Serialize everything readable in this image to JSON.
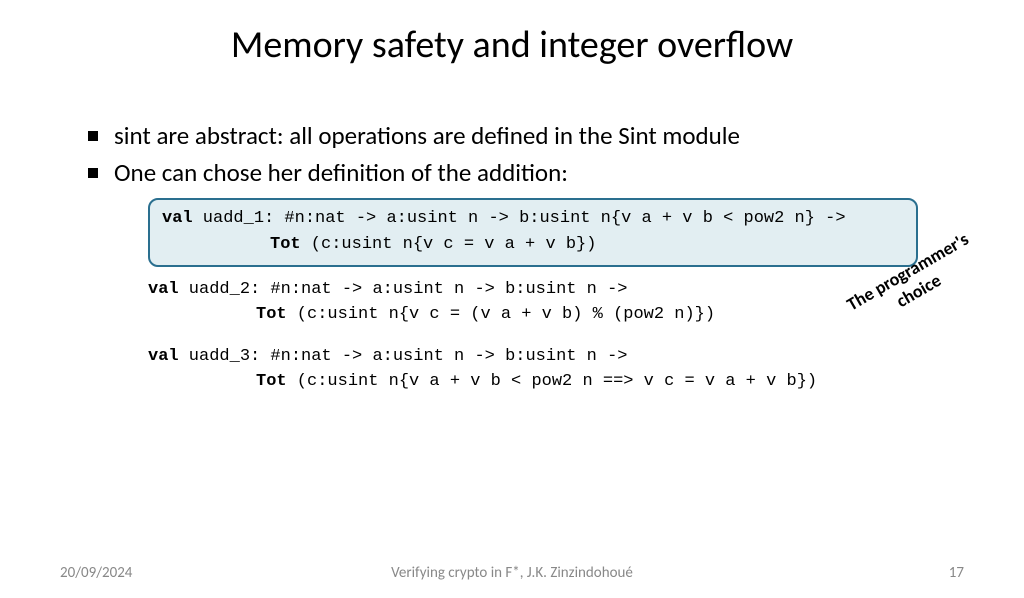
{
  "title": "Memory safety and integer overflow",
  "bullets": [
    "sint are abstract: all operations are defined in the Sint module",
    "One can chose her definition of the addition:"
  ],
  "code": {
    "uadd1": {
      "kw1": "val",
      "line1_rest": " uadd_1: #n:nat -> a:usint n -> b:usint n{v a + v b < pow2 n} ->",
      "kw2": "Tot",
      "line2_rest": " (c:usint n{v c = v a + v b})"
    },
    "uadd2": {
      "kw1": "val",
      "line1_rest": " uadd_2: #n:nat -> a:usint n -> b:usint n ->",
      "kw2": "Tot",
      "line2_rest": " (c:usint n{v c = (v a + v b) % (pow2 n)})"
    },
    "uadd3": {
      "kw1": "val",
      "line1_rest": " uadd_3: #n:nat -> a:usint n -> b:usint n ->",
      "kw2": "Tot",
      "line2_rest": " (c:usint n{v a + v b < pow2 n ==> v c = v a + v b})"
    }
  },
  "annotation": {
    "line1": "The programmer's",
    "line2": "choice"
  },
  "footer": {
    "date": "20/09/2024",
    "center": "Verifying crypto  in F*, J.K. Zinzindohoué",
    "page": "17"
  }
}
